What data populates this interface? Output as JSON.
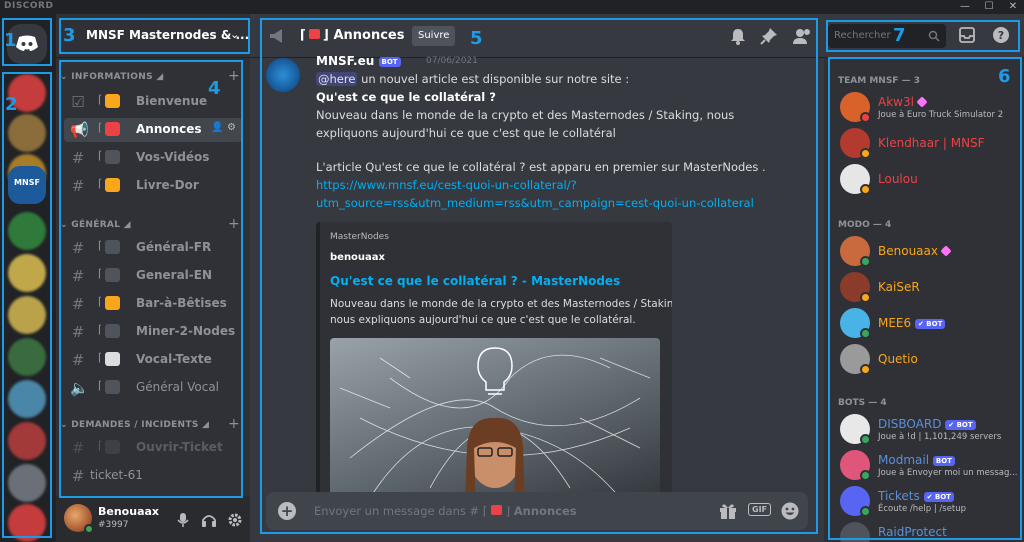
{
  "app": {
    "brand": "DISCORD"
  },
  "window": {
    "minimize": "—",
    "maximize": "☐",
    "close": "✕"
  },
  "server": {
    "name": "MNSF Masternodes & ..."
  },
  "guilds": [
    {
      "color": "#c43c3c"
    },
    {
      "color": "#8a6d3b"
    },
    {
      "color": "#a57c2a"
    },
    {
      "label": "MNSF",
      "color": "#1c5a9c"
    },
    {
      "color": "#2f7a3a"
    },
    {
      "color": "#c0a84a"
    },
    {
      "color": "#b9a24a"
    },
    {
      "color": "#3a6b3e"
    },
    {
      "color": "#4a86a8"
    },
    {
      "color": "#a33a3a"
    },
    {
      "color": "#6a6f78"
    },
    {
      "color": "#c43c3c"
    }
  ],
  "channels": {
    "categories": [
      {
        "label": "INFORMATIONS ◢"
      },
      {
        "label": "GÉNÉRAL ◢"
      },
      {
        "label": "DEMANDES / INCIDENTS ◢"
      }
    ],
    "items": [
      {
        "name": "Bienvenue"
      },
      {
        "name": "Annonces"
      },
      {
        "name": "Vos-Vidéos"
      },
      {
        "name": "Livre-Dor"
      },
      {
        "name": "Général-FR"
      },
      {
        "name": "General-EN"
      },
      {
        "name": "Bar-à-Bêtises"
      },
      {
        "name": "Miner-2-Nodes"
      },
      {
        "name": "Vocal-Texte"
      },
      {
        "name": "Général Vocal"
      },
      {
        "name": "Ouvrir-Ticket"
      },
      {
        "name": "ticket-61"
      }
    ],
    "bracket_open": "⌈",
    "bracket_close": "⌋"
  },
  "user": {
    "name": "Benouaax",
    "tag": "#3997"
  },
  "chat": {
    "channel_title": "Annonces",
    "follow_label": "Suivre",
    "author": "MNSF.eu",
    "bot_label": "BOT",
    "date": "07/06/2021",
    "mention": "@here",
    "line1_rest": " un nouvel article est disponible sur notre site :",
    "headline": "Qu'est ce que le collatéral ?",
    "body1": "Nouveau dans le monde de la crypto et des Masternodes / Staking, nous",
    "body2": "expliquons aujourd'hui ce que c'est que le collatéral",
    "source_line": "L'article Qu'est ce que le collatéral ? est apparu en premier sur MasterNodes .",
    "url1": "https://www.mnsf.eu/cest-quoi-un-collateral/?",
    "url2": "utm_source=rss&utm_medium=rss&utm_campaign=cest-quoi-un-collateral",
    "embed": {
      "provider": "MasterNodes",
      "author": "benouaax",
      "title": "Qu'est ce que le collatéral ? - MasterNodes",
      "desc1": "Nouveau dans le monde de la crypto et des Masternodes / Staking,",
      "desc2": "nous expliquons aujourd'hui ce que c'est que le collatéral."
    },
    "composer_prefix": "Envoyer un message dans # ⌈",
    "composer_channel": "Annonces",
    "gif_label": "GIF"
  },
  "members": {
    "search_placeholder": "Rechercher",
    "groups": [
      {
        "label": "TEAM MNSF — 3"
      },
      {
        "label": "MODO — 4"
      },
      {
        "label": "BOTS — 4"
      }
    ],
    "list": [
      {
        "name": "Akw3l",
        "activity": "Joue à Euro Truck Simulator 2",
        "color": "#ed4245",
        "avatar": "#d9622b",
        "status": "#ed4245"
      },
      {
        "name": "Klendhaar | MNSF",
        "activity": "",
        "color": "#ed4245",
        "avatar": "#b33a2e",
        "status": "#faa61a"
      },
      {
        "name": "Loulou",
        "activity": "",
        "color": "#ed4245",
        "avatar": "#e6e6e6",
        "status": "#faa61a"
      },
      {
        "name": "Benouaax",
        "activity": "",
        "color": "#faa61a",
        "avatar": "#c86a3e",
        "status": "#3ba55d"
      },
      {
        "name": "KaiSeR",
        "activity": "",
        "color": "#faa61a",
        "avatar": "#8a3b2a",
        "status": "#faa61a"
      },
      {
        "name": "MEE6",
        "activity": "",
        "color": "#faa61a",
        "avatar": "#49b3e8",
        "status": "#3ba55d"
      },
      {
        "name": "Quetio",
        "activity": "",
        "color": "#faa61a",
        "avatar": "#9a9a9a",
        "status": "#faa61a"
      },
      {
        "name": "DISBOARD",
        "activity": "Joue à !d | 1,101,249 servers",
        "color": "#5b8fd8",
        "avatar": "#e8e8e8",
        "status": "#3ba55d"
      },
      {
        "name": "Modmail",
        "activity": "Joue à Envoyer moi un messag...",
        "color": "#5b8fd8",
        "avatar": "#e0567a",
        "status": "#3ba55d"
      },
      {
        "name": "Tickets",
        "activity": "Écoute /help | /setup",
        "color": "#5b8fd8",
        "avatar": "#5865f2",
        "status": "#3ba55d"
      },
      {
        "name": "RaidProtect",
        "activity": "",
        "color": "#5b8fd8",
        "avatar": "#4f545c",
        "status": "#3ba55d"
      }
    ],
    "bot_badge": "✔ BOT",
    "bot_badge_plain": "BOT"
  },
  "annotations": [
    "1",
    "2",
    "3",
    "4",
    "5",
    "6",
    "7"
  ],
  "colors": {
    "accent": "#1e9be6",
    "blurple": "#5865f2",
    "link": "#00aff4"
  }
}
